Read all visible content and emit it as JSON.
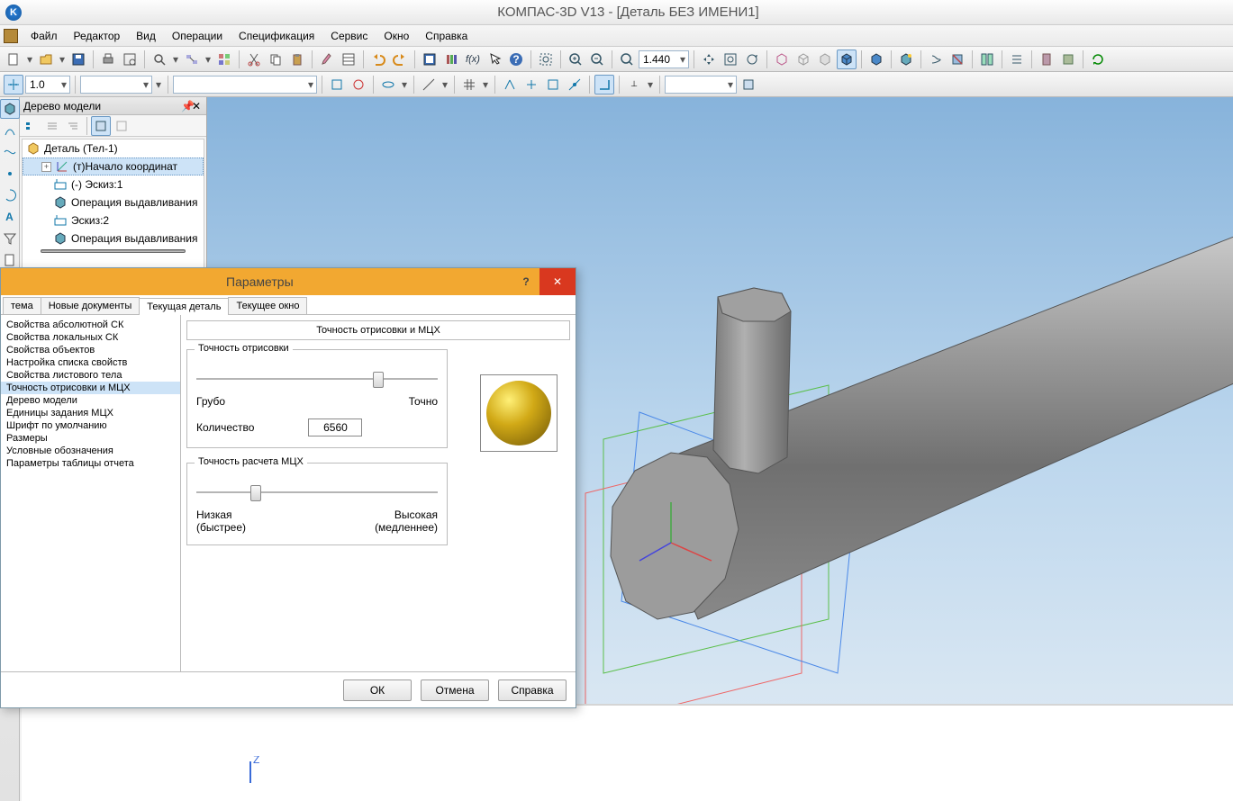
{
  "app": {
    "title": "КОМПАС-3D V13 - [Деталь БЕЗ ИМЕНИ1]"
  },
  "menu": {
    "file": "Файл",
    "edit": "Редактор",
    "view": "Вид",
    "ops": "Операции",
    "spec": "Спецификация",
    "service": "Сервис",
    "window": "Окно",
    "help": "Справка"
  },
  "toolbar2": {
    "scale": "1.0",
    "zoom_value": "1.440"
  },
  "tree": {
    "title": "Дерево модели",
    "root": "Деталь (Тел-1)",
    "origin": "(т)Начало координат",
    "sketch1": "(-) Эскиз:1",
    "extr1": "Операция выдавливания",
    "sketch2": "Эскиз:2",
    "extr2": "Операция выдавливания"
  },
  "dialog": {
    "title": "Параметры",
    "tabs": {
      "t0": "тема",
      "t1": "Новые документы",
      "t2": "Текущая деталь",
      "t3": "Текущее окно"
    },
    "side": {
      "i0": "Свойства абсолютной СК",
      "i1": "Свойства локальных СК",
      "i2": "Свойства объектов",
      "i3": "Настройка списка свойств",
      "i4": "Свойства листового тела",
      "i5": "Точность отрисовки и МЦХ",
      "i6": "Дерево модели",
      "i7": "Единицы задания МЦХ",
      "i8": "Шрифт по умолчанию",
      "i9": "Размеры",
      "i10": "Условные обозначения",
      "i11": "Параметры таблицы отчета"
    },
    "main": {
      "group_title": "Точность отрисовки и МЦХ",
      "fs1": {
        "legend": "Точность отрисовки",
        "low": "Грубо",
        "high": "Точно",
        "count_label": "Количество",
        "count_value": "6560"
      },
      "fs2": {
        "legend": "Точность расчета МЦХ",
        "low1": "Низкая",
        "low2": "(быстрее)",
        "high1": "Высокая",
        "high2": "(медленнее)"
      }
    },
    "buttons": {
      "ok": "ОК",
      "cancel": "Отмена",
      "help": "Справка"
    }
  }
}
